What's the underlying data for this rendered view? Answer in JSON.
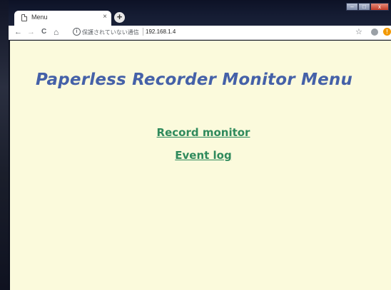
{
  "browser": {
    "tab": {
      "title": "Menu",
      "close_glyph": "×",
      "page_icon": "page-icon"
    },
    "new_tab_glyph": "+",
    "window_controls": {
      "minimize": "–",
      "maximize": "□",
      "close": "x"
    },
    "toolbar": {
      "back_glyph": "←",
      "forward_glyph": "→",
      "reload_glyph": "C",
      "home_glyph": "⌂",
      "info_glyph": "i",
      "security_text": "保護されていない通信",
      "url": "192.168.1.4",
      "bookmark_glyph": "☆",
      "update_glyph": "!"
    }
  },
  "page": {
    "heading": "Paperless Recorder Monitor Menu",
    "links": [
      {
        "label": "Record monitor"
      },
      {
        "label": "Event log"
      }
    ],
    "colors": {
      "background": "#fbfadc",
      "heading": "#4561a8",
      "link": "#2f8a5c"
    }
  }
}
